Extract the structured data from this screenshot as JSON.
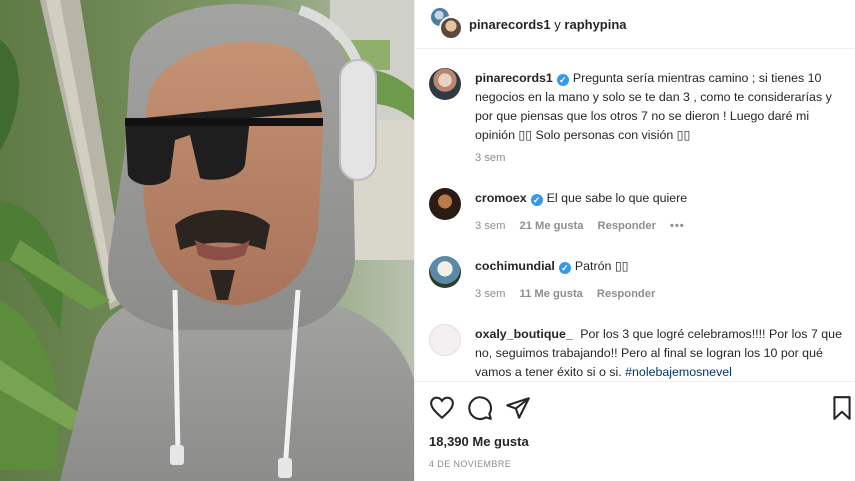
{
  "header": {
    "user1": "pinarecords1",
    "joiner": "y",
    "user2": "raphypina"
  },
  "caption": {
    "user": "pinarecords1",
    "text": "Pregunta sería mientras camino ; si tienes 10 negocios en la mano y solo se te dan 3 , como te considerarías y por que piensas que los otros 7 no se dieron ! Luego daré mi opinión ▯▯ Solo personas con visión ▯▯",
    "time": "3 sem"
  },
  "comments": [
    {
      "user": "cromoex",
      "verified": true,
      "text": "El que sabe lo que quiere",
      "time": "3 sem",
      "likes": "21 Me gusta",
      "reply": "Responder",
      "more": "•••"
    },
    {
      "user": "cochimundial",
      "verified": true,
      "text": "Patrón ▯▯",
      "time": "3 sem",
      "likes": "11 Me gusta",
      "reply": "Responder"
    },
    {
      "user": "oxaly_boutique_",
      "verified": false,
      "text": "Por los 3 que logré celebramos!!!! Por los 7 que no, seguimos trabajando!! Pero al final se logran los 10 por qué vamos a tener éxito si o si.",
      "hashtag": "#nolebajemosnevel"
    }
  ],
  "icons": [
    "heart-icon",
    "comment-icon",
    "share-icon",
    "bookmark-icon"
  ],
  "likes": "18,390 Me gusta",
  "date": "4 DE NOVIEMBRE",
  "colors": {
    "verified": "#3897f0",
    "meta": "#8e8e8e",
    "hashtag": "#00376b",
    "border": "#efefef"
  }
}
